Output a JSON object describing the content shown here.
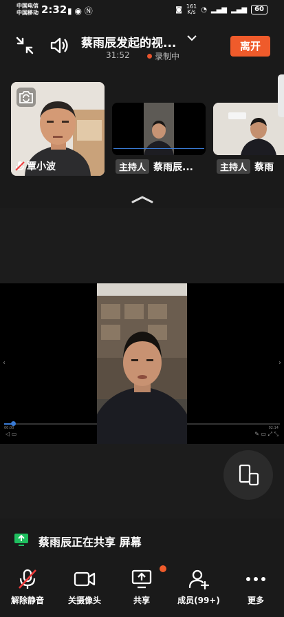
{
  "status_bar": {
    "carrier_1": "中国电信",
    "carrier_2": "中国移动",
    "time": "2:32",
    "net_speed_value": "161",
    "net_speed_unit": "K/s",
    "battery": "60"
  },
  "meeting": {
    "title": "蔡雨辰发起的视...",
    "elapsed": "31:52",
    "recording_label": "录制中",
    "leave_label": "离开"
  },
  "participants": [
    {
      "name": "覃小波"
    },
    {
      "badge": "主持人",
      "name": "蔡雨辰..."
    },
    {
      "badge": "主持人",
      "name": "蔡雨"
    }
  ],
  "share_notice": "蔡雨辰正在共享 屏幕",
  "player": {
    "time_start": "00:00",
    "time_end": "02:14"
  },
  "toolbar": {
    "mute_label": "解除静音",
    "camera_label": "关摄像头",
    "share_label": "共享",
    "members_label": "成员(99+)",
    "more_label": "更多"
  },
  "colors": {
    "accent": "#ef5b2b",
    "share_icon": "#1fbf5f"
  }
}
